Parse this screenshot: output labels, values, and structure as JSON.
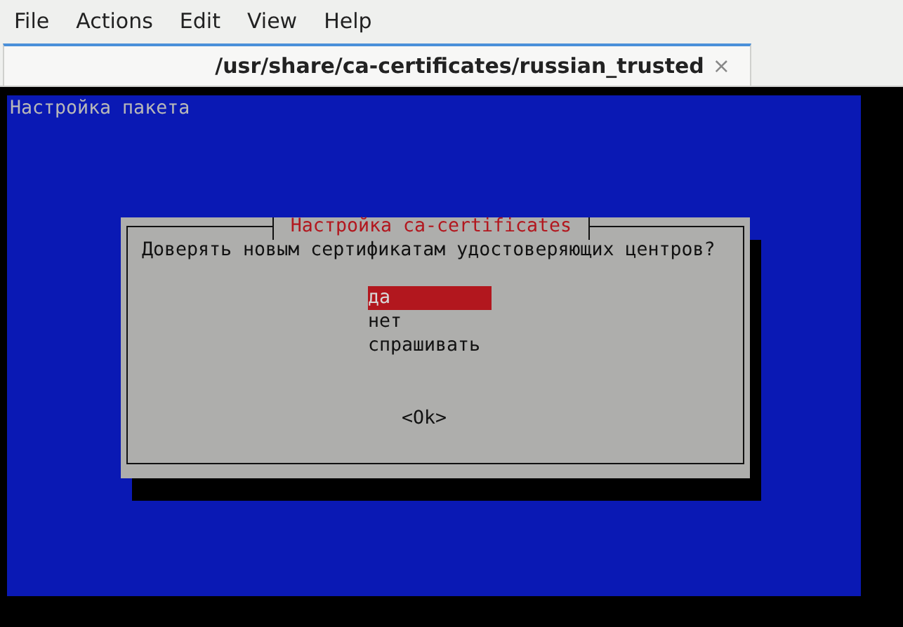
{
  "menu": [
    "File",
    "Actions",
    "Edit",
    "View",
    "Help"
  ],
  "tabs": [
    {
      "label": "/usr/share/ca-certificates/russian_trusted",
      "selected": true,
      "close": "×"
    }
  ],
  "terminal": {
    "backtitle": "Настройка пакета",
    "dialog": {
      "title": "Настройка ca-certificates",
      "question": "Доверять новым сертификатам удостоверяющих центров?",
      "options": [
        {
          "label": "да",
          "selected": true
        },
        {
          "label": "нет",
          "selected": false
        },
        {
          "label": "спрашивать",
          "selected": false
        }
      ],
      "button": "<Ok>"
    }
  }
}
